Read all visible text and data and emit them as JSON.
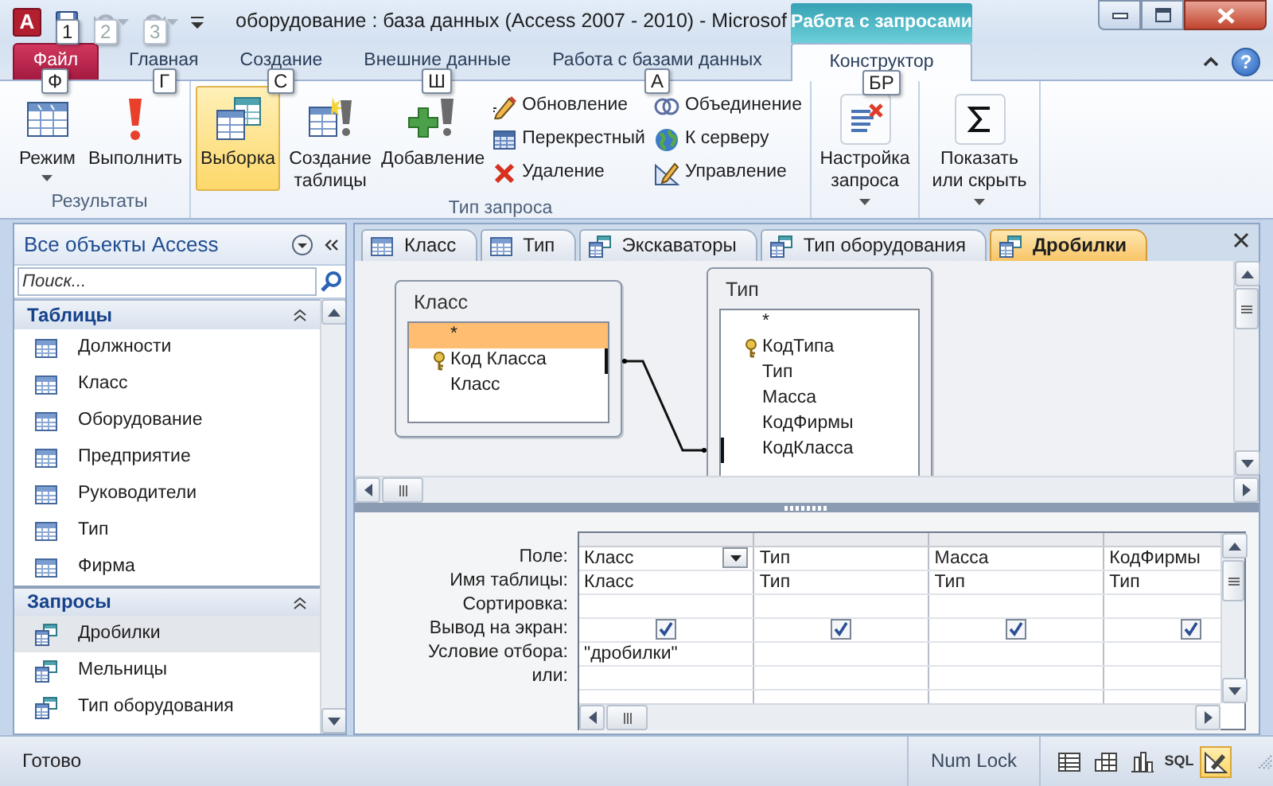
{
  "window": {
    "app_icon": "A",
    "title": "оборудование : база данных (Access 2007 - 2010)  -  Microsof",
    "context_group": "Работа с запросами"
  },
  "quick_access": [
    {
      "kind": "save",
      "keytip": "1",
      "disabled": false
    },
    {
      "kind": "undo",
      "keytip": "2",
      "disabled": true
    },
    {
      "kind": "redo",
      "keytip": "3",
      "disabled": true
    }
  ],
  "ribbon_tabs": [
    {
      "label": "Файл",
      "kind": "file",
      "keytip": "Ф",
      "selected": false
    },
    {
      "label": "Главная",
      "kind": "tab",
      "keytip": "Г",
      "selected": false
    },
    {
      "label": "Создание",
      "kind": "tab",
      "keytip": "С",
      "selected": false
    },
    {
      "label": "Внешние данные",
      "kind": "tab",
      "keytip": "Ш",
      "selected": false
    },
    {
      "label": "Работа с базами данных",
      "kind": "tab",
      "keytip": "А",
      "selected": false
    },
    {
      "label": "Конструктор",
      "kind": "context",
      "keytip": "БР",
      "selected": true
    }
  ],
  "help": "?",
  "ribbon_groups": [
    {
      "label": "Результаты",
      "buttons": [
        {
          "label": "Режим",
          "kind": "large",
          "dropdown": true,
          "selected": false
        },
        {
          "label": "Выполнить",
          "kind": "large",
          "dropdown": false,
          "selected": false
        }
      ]
    },
    {
      "label": "Тип запроса",
      "buttons": [
        {
          "label": "Выборка",
          "kind": "large",
          "dropdown": false,
          "selected": true
        },
        {
          "label": "Создание таблицы",
          "kind": "large",
          "dropdown": false,
          "selected": false
        },
        {
          "label": "Добавление",
          "kind": "large",
          "dropdown": false,
          "selected": false
        },
        {
          "label": "Обновление",
          "kind": "small"
        },
        {
          "label": "Перекрестный",
          "kind": "small"
        },
        {
          "label": "Удаление",
          "kind": "small"
        },
        {
          "label": "Объединение",
          "kind": "small"
        },
        {
          "label": "К серверу",
          "kind": "small"
        },
        {
          "label": "Управление",
          "kind": "small"
        }
      ]
    },
    {
      "buttons": [
        {
          "label": "Настройка запроса",
          "kind": "large",
          "dropdown": true,
          "selected": false
        }
      ]
    },
    {
      "buttons": [
        {
          "label": "Показать или скрыть",
          "kind": "large",
          "dropdown": true,
          "selected": false
        }
      ]
    }
  ],
  "nav": {
    "title": "Все объекты Access",
    "search_placeholder": "Поиск...",
    "sections": [
      {
        "title": "Таблицы",
        "kind": "table",
        "items": [
          {
            "label": "Должности",
            "selected": false
          },
          {
            "label": "Класс",
            "selected": false
          },
          {
            "label": "Оборудование",
            "selected": false
          },
          {
            "label": "Предприятие",
            "selected": false
          },
          {
            "label": "Руководители",
            "selected": false
          },
          {
            "label": "Тип",
            "selected": false
          },
          {
            "label": "Фирма",
            "selected": false
          }
        ]
      },
      {
        "title": "Запросы",
        "kind": "query",
        "items": [
          {
            "label": "Дробилки",
            "selected": true
          },
          {
            "label": "Мельницы",
            "selected": false
          },
          {
            "label": "Тип оборудования",
            "selected": false
          }
        ]
      }
    ]
  },
  "doc_tabs": [
    {
      "label": "Класс",
      "kind": "table",
      "selected": false
    },
    {
      "label": "Тип",
      "kind": "table",
      "selected": false
    },
    {
      "label": "Экскаваторы",
      "kind": "query",
      "selected": false
    },
    {
      "label": "Тип оборудования",
      "kind": "query",
      "selected": false
    },
    {
      "label": "Дробилки",
      "kind": "query",
      "selected": true
    }
  ],
  "designer": {
    "tables": [
      {
        "title": "Класс",
        "fields": [
          {
            "name": "*",
            "key": false,
            "selected": true,
            "joined": false
          },
          {
            "name": "Код Класса",
            "key": true,
            "selected": false,
            "joined": true
          },
          {
            "name": "Класс",
            "key": false,
            "selected": false,
            "joined": false
          }
        ]
      },
      {
        "title": "Тип",
        "fields": [
          {
            "name": "*",
            "key": false,
            "selected": false,
            "joined": false
          },
          {
            "name": "КодТипа",
            "key": true,
            "selected": false,
            "joined": false
          },
          {
            "name": "Тип",
            "key": false,
            "selected": false,
            "joined": false
          },
          {
            "name": "Масса",
            "key": false,
            "selected": false,
            "joined": false
          },
          {
            "name": "КодФирмы",
            "key": false,
            "selected": false,
            "joined": false
          },
          {
            "name": "КодКласса",
            "key": false,
            "selected": false,
            "joined": true
          }
        ]
      }
    ]
  },
  "grid": {
    "row_labels": [
      "Поле:",
      "Имя таблицы:",
      "Сортировка:",
      "Вывод на экран:",
      "Условие отбора:",
      "или:"
    ],
    "columns": [
      {
        "field": "Класс",
        "table": "Класс",
        "show": true,
        "criteria": "\"дробилки\"",
        "active": true
      },
      {
        "field": "Тип",
        "table": "Тип",
        "show": true,
        "active": false
      },
      {
        "field": "Масса",
        "table": "Тип",
        "show": true,
        "active": false
      },
      {
        "field": "КодФирмы",
        "table": "Тип",
        "show": true,
        "active": false
      }
    ]
  },
  "status_bar": {
    "text": "Готово",
    "indicators": [
      "Num Lock"
    ],
    "views": [
      {
        "kind": "datasheet",
        "selected": false
      },
      {
        "kind": "pivottable",
        "selected": false
      },
      {
        "kind": "pivotchart",
        "selected": false
      },
      {
        "kind": "sql",
        "label": "SQL",
        "selected": false
      },
      {
        "kind": "design",
        "selected": true
      }
    ]
  }
}
